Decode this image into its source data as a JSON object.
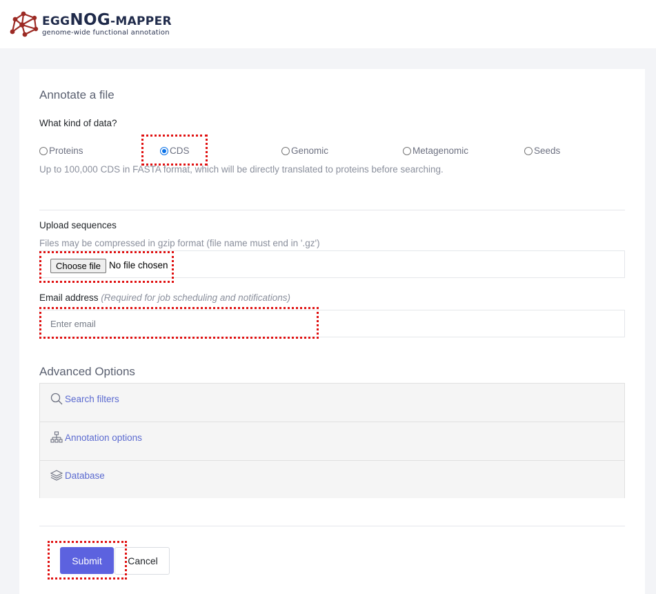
{
  "header": {
    "logo_word_1": "EGG",
    "logo_word_2": "NOG",
    "logo_word_3": "-MAPPER",
    "logo_tagline": "genome-wide functional annotation",
    "logo_icon": "network-graph-icon"
  },
  "form": {
    "title": "Annotate a file",
    "data_kind_question": "What kind of data?",
    "data_types": [
      {
        "label": "Proteins",
        "checked": false
      },
      {
        "label": "CDS",
        "checked": true
      },
      {
        "label": "Genomic",
        "checked": false
      },
      {
        "label": "Metagenomic",
        "checked": false
      },
      {
        "label": "Seeds",
        "checked": false
      }
    ],
    "data_type_hint": "Up to 100,000 CDS in FASTA format, which will be directly translated to proteins before searching.",
    "upload": {
      "label": "Upload sequences",
      "hint": "Files may be compressed in gzip format (file name must end in '.gz')",
      "button_label": "Choose file",
      "status": "No file chosen"
    },
    "email": {
      "label": "Email address",
      "label_note": "(Required for job scheduling and notifications)",
      "placeholder": "Enter email"
    }
  },
  "advanced": {
    "title": "Advanced Options",
    "sections": [
      {
        "label": "Search filters",
        "icon": "search-icon"
      },
      {
        "label": "Annotation options",
        "icon": "sitemap-icon"
      },
      {
        "label": "Database",
        "icon": "layers-icon"
      }
    ]
  },
  "actions": {
    "submit_label": "Submit",
    "cancel_label": "Cancel"
  },
  "colors": {
    "accent": "#5c62df",
    "link": "#5b6ad0",
    "highlight": "#e01010",
    "radio_checked": "#0b72e7"
  }
}
